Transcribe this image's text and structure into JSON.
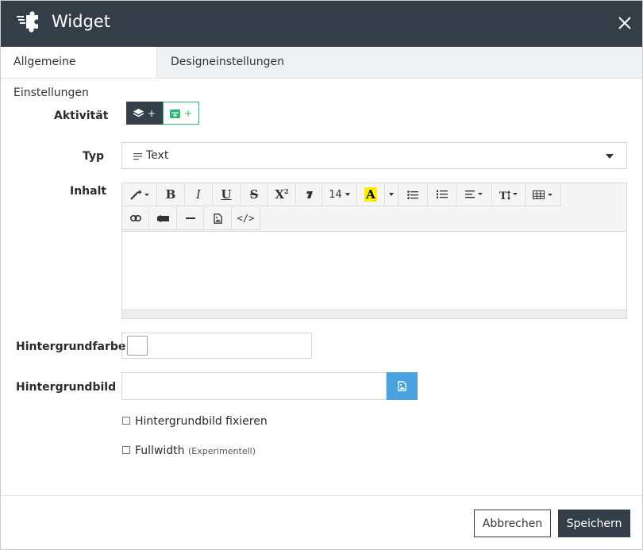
{
  "header": {
    "title": "Widget",
    "logo_icon": "puzzle-icon",
    "close_icon": "close-icon"
  },
  "tabs": [
    {
      "label": "Allgemeine Einstellungen",
      "active": true
    },
    {
      "label": "Designeinstellungen",
      "active": false
    }
  ],
  "form": {
    "activity_label": "Aktivität",
    "activity_add1": "+",
    "activity_add2": "+",
    "type_label": "Typ",
    "type_value": "Text",
    "content_label": "Inhalt",
    "font_size": "14",
    "bgcolor_label": "Hintergrundfarbe",
    "bgimage_label": "Hintergrundbild",
    "fix_bg_label": "Hintergrundbild fixieren",
    "fullwidth_label": "Fullwidth",
    "fullwidth_note": "(Experimentell)"
  },
  "footer": {
    "cancel_label": "Abbrechen",
    "save_label": "Speichern"
  },
  "colors": {
    "header_bg": "#343e48",
    "accent_green": "#2bb673",
    "image_button": "#4aa3df"
  }
}
